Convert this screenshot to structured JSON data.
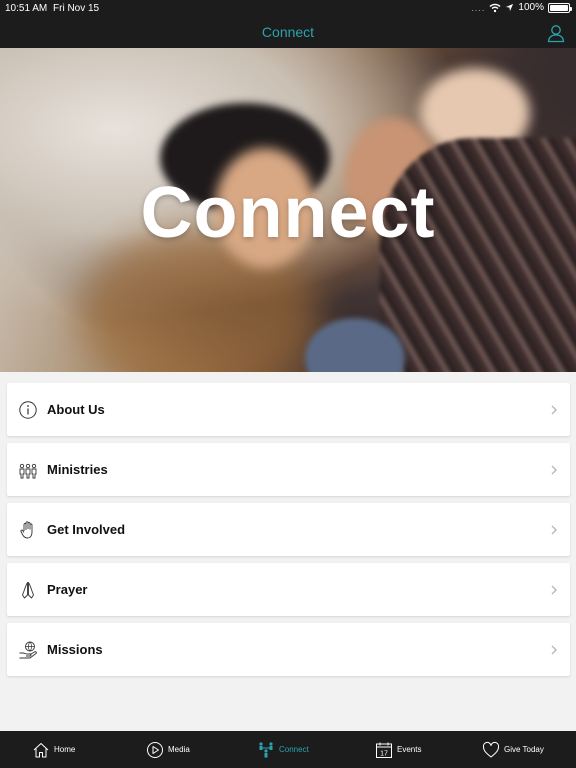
{
  "status_bar": {
    "time": "10:51 AM",
    "date": "Fri Nov 15",
    "signal": "....",
    "battery": "100%",
    "battery_level": 1.0
  },
  "nav": {
    "title": "Connect",
    "profile_icon": "person-outline-icon"
  },
  "hero": {
    "title": "Connect"
  },
  "menu": {
    "items": [
      {
        "label": "About Us",
        "icon": "info-circle-icon"
      },
      {
        "label": "Ministries",
        "icon": "people-group-icon"
      },
      {
        "label": "Get Involved",
        "icon": "raised-hand-icon"
      },
      {
        "label": "Prayer",
        "icon": "praying-hands-icon"
      },
      {
        "label": "Missions",
        "icon": "globe-in-hand-icon"
      }
    ]
  },
  "tabs": [
    {
      "label": "Home",
      "icon": "house-icon"
    },
    {
      "label": "Media",
      "icon": "play-circle-icon"
    },
    {
      "label": "Connect",
      "icon": "connect-people-icon",
      "active": true
    },
    {
      "label": "Events",
      "icon": "calendar-icon",
      "calendar_day": "17"
    },
    {
      "label": "Give Today",
      "icon": "heart-icon"
    }
  ],
  "colors": {
    "bar": "#1c1c1c",
    "accent": "#2ba3ad",
    "background": "#f2f2f2"
  }
}
